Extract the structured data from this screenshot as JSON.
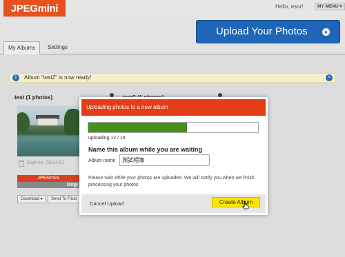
{
  "header": {
    "logo": "JPEGmini",
    "greeting": "Hello, esor!",
    "menu_label": "MY MENU ▾",
    "upload_button": "Upload Your Photos",
    "upload_icon": "●"
  },
  "tabs": [
    {
      "label": "My Albums",
      "active": true
    },
    {
      "label": "Settings",
      "active": false
    }
  ],
  "notice": {
    "text": "Album \"test2\" is now ready!",
    "info_icon": "i",
    "close_icon": "×"
  },
  "albums": [
    {
      "title": "test (1 photos)",
      "expires": "Expires: 08/14/11",
      "brand": "JPEGmini",
      "original_label": "Origi",
      "download_label": "Download",
      "flickr_label": "Send To Flickr"
    },
    {
      "title": "test2 (1 photos)"
    }
  ],
  "modal": {
    "title": "Uploading photos to a new album",
    "progress": {
      "done": 12,
      "total": 18,
      "text": "uploading 12 / 18",
      "fraction": 0.5833
    },
    "name_heading": "Name this album while you are waiting",
    "name_label": "Album name",
    "name_value": "測試相簿",
    "wait_text": "Please wait while your photos are uploaded. We will notify you when we finish processing your photos.",
    "cancel_label": "Cancel Upload",
    "create_label": "Create Album"
  },
  "colors": {
    "brand_orange": "#e8501e",
    "modal_red": "#e33d1a",
    "upload_blue": "#1f66b8",
    "progress_green": "#4a8f1e",
    "create_yellow": "#ffe600"
  }
}
